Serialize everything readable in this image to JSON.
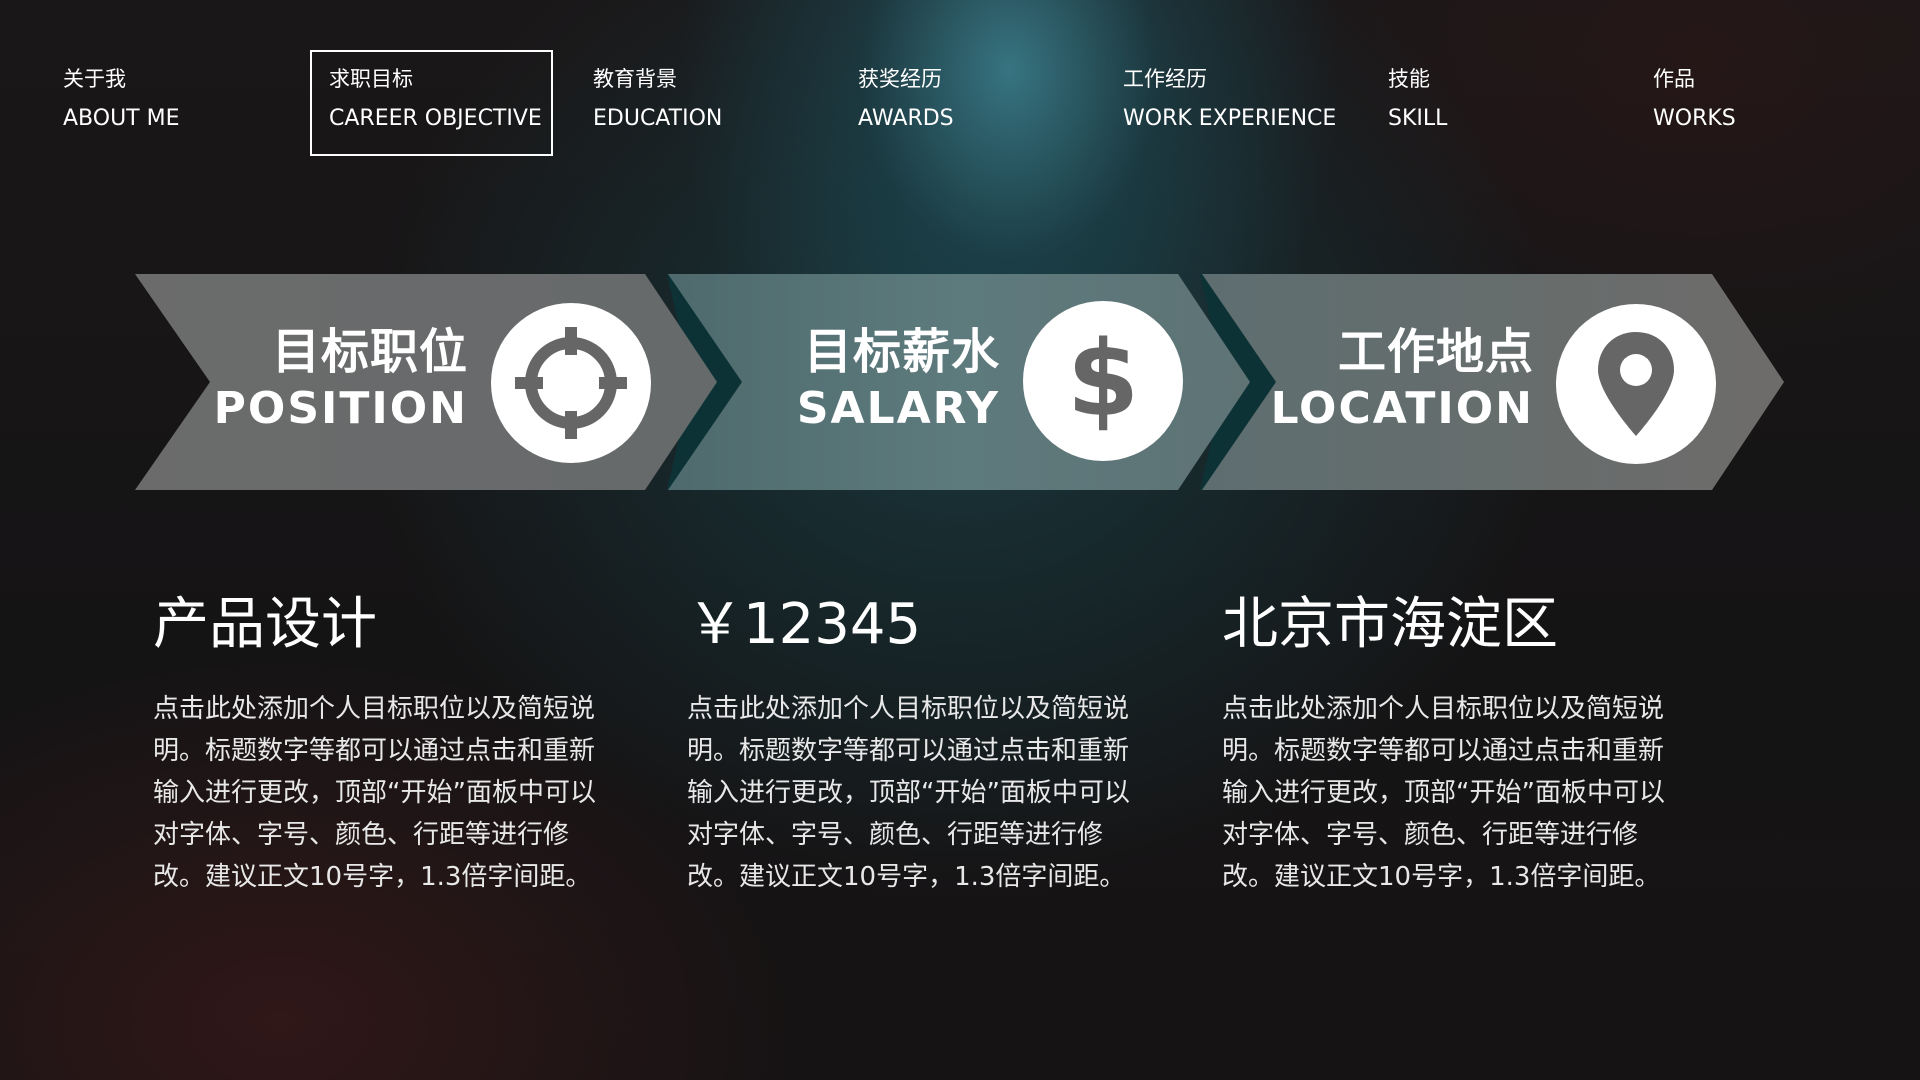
{
  "nav": {
    "items": [
      {
        "cn": "关于我",
        "en": "ABOUT ME"
      },
      {
        "cn": "求职目标",
        "en": "CAREER OBJECTIVE"
      },
      {
        "cn": "教育背景",
        "en": "EDUCATION"
      },
      {
        "cn": "获奖经历",
        "en": "AWARDS"
      },
      {
        "cn": "工作经历",
        "en": "WORK EXPERIENCE"
      },
      {
        "cn": "技能",
        "en": "SKILL"
      },
      {
        "cn": "作品",
        "en": "WORKS"
      }
    ],
    "active_index": 1
  },
  "objectives": [
    {
      "title_cn": "目标职位",
      "title_en": "POSITION",
      "icon": "crosshair-icon",
      "value": "产品设计",
      "description": "点击此处添加个人目标职位以及简短说明。标题数字等都可以通过点击和重新输入进行更改，顶部“开始”面板中可以对字体、字号、颜色、行距等进行修改。建议正文10号字，1.3倍字间距。"
    },
    {
      "title_cn": "目标薪水",
      "title_en": "SALARY",
      "icon": "dollar-icon",
      "value": "￥12345",
      "description": "点击此处添加个人目标职位以及简短说明。标题数字等都可以通过点击和重新输入进行更改，顶部“开始”面板中可以对字体、字号、颜色、行距等进行修改。建议正文10号字，1.3倍字间距。"
    },
    {
      "title_cn": "工作地点",
      "title_en": "LOCATION",
      "icon": "map-pin-icon",
      "value": "北京市海淀区",
      "description": "点击此处添加个人目标职位以及简短说明。标题数字等都可以通过点击和重新输入进行更改，顶部“开始”面板中可以对字体、字号、颜色、行距等进行修改。建议正文10号字，1.3倍字间距。"
    }
  ],
  "colors": {
    "chevron": "#6a6a6a",
    "chevron_middle": "#5a7275",
    "badge": "#ffffff",
    "icon": "#666666",
    "text": "#ffffff"
  }
}
